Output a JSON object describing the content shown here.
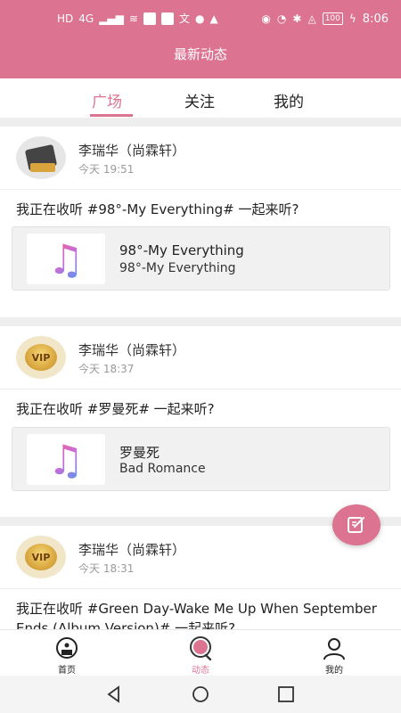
{
  "status": {
    "left_icons": [
      "HD",
      "4G"
    ],
    "battery": "100",
    "time": "8:06"
  },
  "header": {
    "title": "最新动态"
  },
  "tabs": [
    {
      "label": "广场",
      "active": true
    },
    {
      "label": "关注",
      "active": false
    },
    {
      "label": "我的",
      "active": false
    }
  ],
  "posts": [
    {
      "user": "李瑞华（尚霖轩）",
      "time": "今天 19:51",
      "text": "我正在收听 #98°-My Everything# 一起来听?",
      "music": {
        "title": "98°-My Everything",
        "artist": "98°-My Everything"
      }
    },
    {
      "user": "李瑞华（尚霖轩）",
      "time": "今天 18:37",
      "text": "我正在收听 #罗曼死# 一起来听?",
      "music": {
        "title": "罗曼死",
        "artist": "Bad Romance"
      }
    },
    {
      "user": "李瑞华（尚霖轩）",
      "time": "今天 18:31",
      "text": "我正在收听 #Green Day-Wake Me Up When September Ends (Album Version)# 一起来听?"
    }
  ],
  "vip_label": "VIP",
  "bottom_nav": [
    {
      "label": "首页",
      "icon": "home-disc-icon",
      "active": false
    },
    {
      "label": "动态",
      "icon": "moments-icon",
      "active": true
    },
    {
      "label": "我的",
      "icon": "profile-icon",
      "active": false
    }
  ],
  "colors": {
    "accent": "#dc7391",
    "separator": "#eeeeee"
  }
}
